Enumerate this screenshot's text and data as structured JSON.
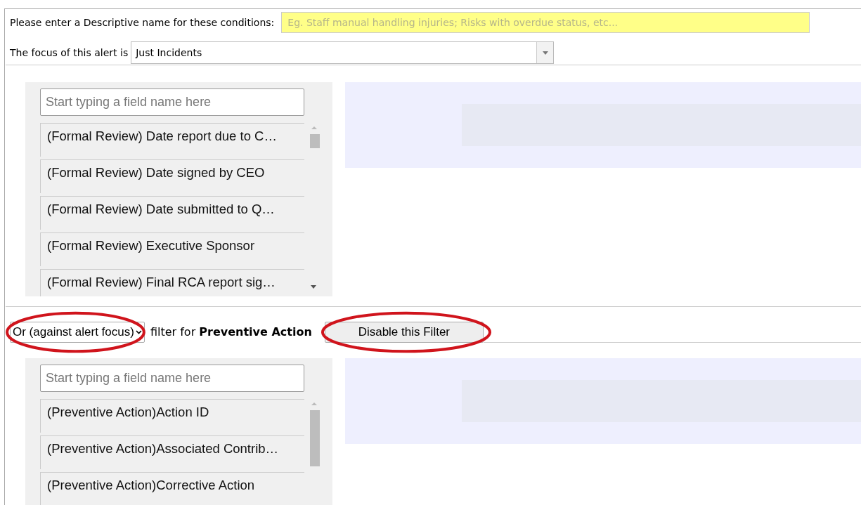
{
  "name_row": {
    "label": "Please enter a Descriptive name for these conditions:",
    "placeholder": "Eg. Staff manual handling injuries; Risks with overdue status, etc..."
  },
  "focus_row": {
    "label": "The focus of this alert is",
    "value": "Just Incidents"
  },
  "first_filter": {
    "search_placeholder": "Start typing a field name here",
    "fields": [
      "(Formal Review) Date report due to C…",
      "(Formal Review) Date signed by CEO",
      "(Formal Review) Date submitted to Q…",
      "(Formal Review) Executive Sponsor",
      "(Formal Review) Final RCA report sig…"
    ]
  },
  "filter_bar": {
    "combinator": "Or (against alert focus)",
    "caption": "filter for **Preventive Action**",
    "button": "Disable this Filter"
  },
  "second_filter": {
    "search_placeholder": "Start typing a field name here",
    "fields": [
      "(Preventive Action)Action ID",
      "(Preventive Action)Associated Contrib…",
      "(Preventive Action)Corrective Action"
    ]
  }
}
